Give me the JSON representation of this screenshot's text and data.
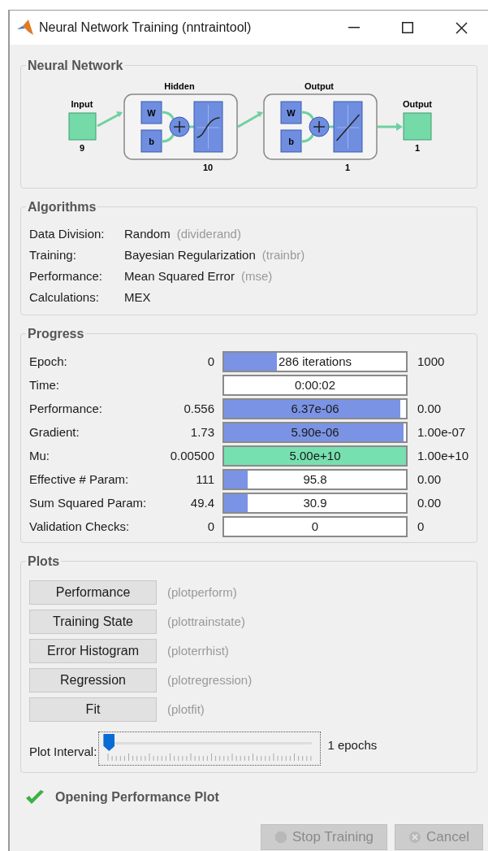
{
  "window": {
    "title": "Neural Network Training (nntraintool)"
  },
  "network": {
    "title": "Neural Network",
    "input": {
      "label": "Input",
      "size": "9"
    },
    "layers": [
      {
        "title": "Hidden",
        "size": "10",
        "weight": "W",
        "bias": "b",
        "kind": "sigmoid"
      },
      {
        "title": "Output",
        "size": "1",
        "weight": "W",
        "bias": "b",
        "kind": "linear"
      }
    ],
    "output": {
      "label": "Output",
      "size": "1"
    }
  },
  "algorithms": {
    "title": "Algorithms",
    "rows": [
      {
        "label": "Data Division:",
        "value": "Random",
        "function": "(dividerand)"
      },
      {
        "label": "Training:",
        "value": "Bayesian Regularization",
        "function": "(trainbr)"
      },
      {
        "label": "Performance:",
        "value": "Mean Squared Error",
        "function": "(mse)"
      },
      {
        "label": "Calculations:",
        "value": "MEX"
      }
    ]
  },
  "progress": {
    "title": "Progress",
    "rows": [
      {
        "label": "Epoch:",
        "start": "0",
        "reading": "286 iterations",
        "level": 0.29,
        "color": "#7b93e4",
        "end": "1000"
      },
      {
        "label": "Time:",
        "reading": "0:00:02"
      },
      {
        "label": "Performance:",
        "start": "0.556",
        "reading": "6.37e-06",
        "level": 0.97,
        "color": "#7b93e4",
        "end": "0.00"
      },
      {
        "label": "Gradient:",
        "start": "1.73",
        "reading": "5.90e-06",
        "level": 0.985,
        "color": "#7b93e4",
        "end": "1.00e-07"
      },
      {
        "label": "Mu:",
        "start": "0.00500",
        "reading": "5.00e+10",
        "level": 1,
        "color": "#77e0b0",
        "end": "1.00e+10"
      },
      {
        "label": "Effective # Param:",
        "start": "111",
        "reading": "95.8",
        "level": 0.13,
        "color": "#7b93e4",
        "end": "0.00"
      },
      {
        "label": "Sum Squared Param:",
        "start": "49.4",
        "reading": "30.9",
        "level": 0.13,
        "color": "#7b93e4",
        "end": "0.00"
      },
      {
        "label": "Validation Checks:",
        "start": "0",
        "reading": "0",
        "end": "0"
      }
    ]
  },
  "plots": {
    "title": "Plots",
    "buttons": [
      {
        "label": "Performance",
        "function": "(plotperform)"
      },
      {
        "label": "Training State",
        "function": "(plottrainstate)"
      },
      {
        "label": "Error Histogram",
        "function": "(ploterrhist)"
      },
      {
        "label": "Regression",
        "function": "(plotregression)"
      },
      {
        "label": "Fit",
        "function": "(plotfit)"
      }
    ],
    "interval": {
      "label": "Plot Interval:",
      "level": 0,
      "reading": "1 epochs"
    }
  },
  "status": {
    "message": "Opening Performance Plot",
    "ok": true
  },
  "buttons": [
    {
      "label": "Stop Training",
      "kind": "stop",
      "disabled": true
    },
    {
      "label": "Cancel",
      "kind": "cancel",
      "disabled": true
    }
  ]
}
